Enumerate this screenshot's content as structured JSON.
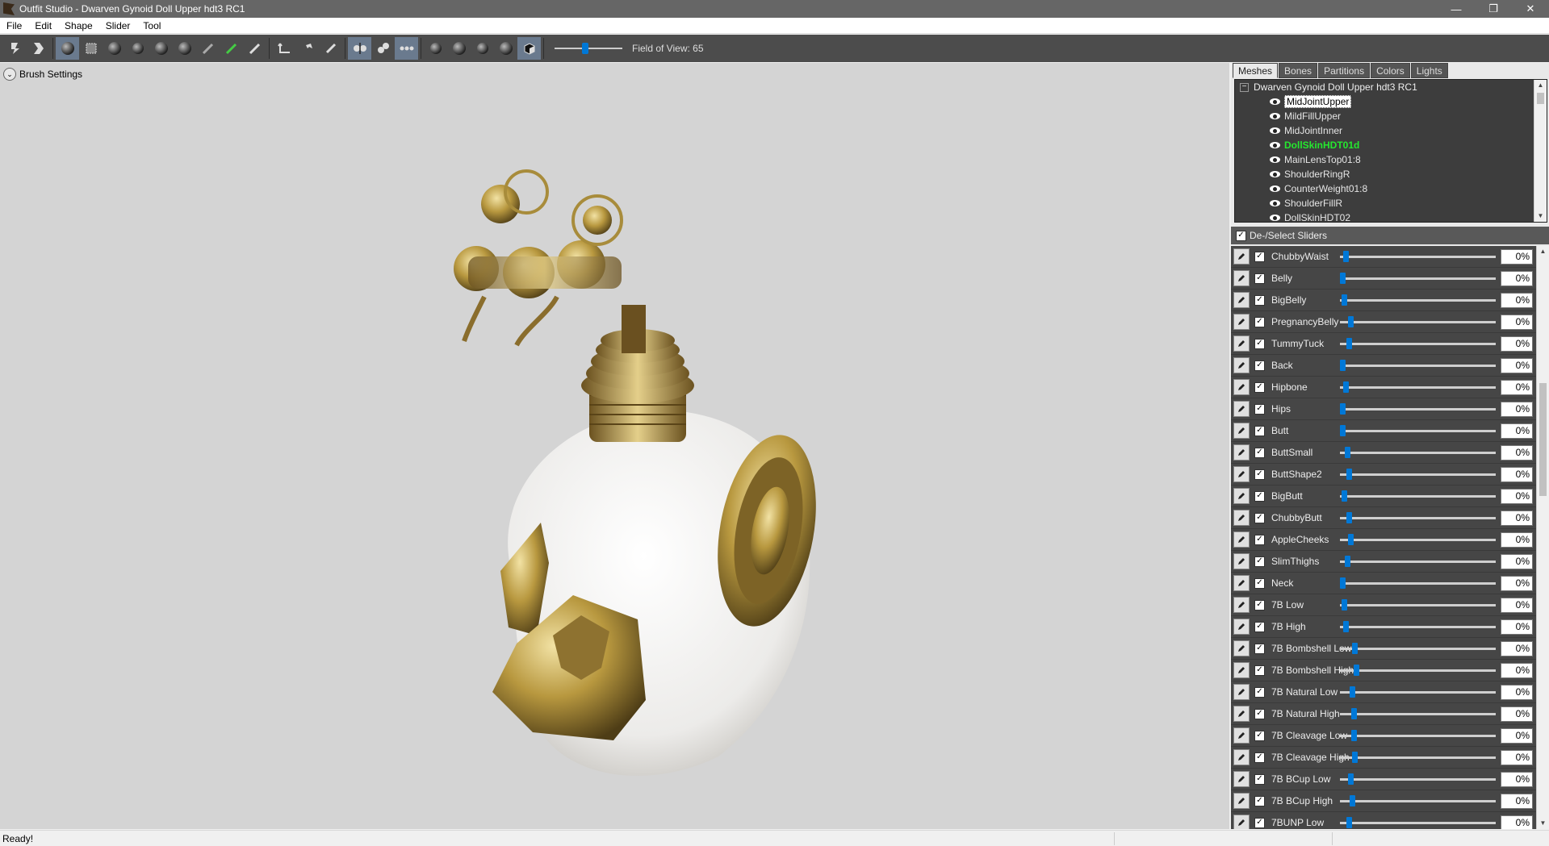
{
  "window": {
    "title": "Outfit Studio - Dwarven Gynoid Doll Upper hdt3 RC1",
    "controls": [
      "—",
      "❐",
      "✕"
    ]
  },
  "menu": [
    "File",
    "Edit",
    "Shape",
    "Slider",
    "Tool"
  ],
  "toolbar": {
    "field_of_view_label": "Field of View: 65",
    "field_of_view_level": 0.45,
    "icons": [
      "save-project-icon",
      "load-project-icon",
      "select-brush-icon",
      "mask-brush-icon",
      "inflate-brush-icon",
      "deflate-brush-icon",
      "move-brush-icon",
      "smooth-brush-icon",
      "undiff-brush-icon",
      "weight-brush-icon",
      "color-brush-icon",
      "transform-tool-icon",
      "pivot-tool-icon",
      "vertex-edit-icon",
      "x-mirror-icon",
      "connected-only-icon",
      "global-brush-icon",
      "view-front-icon",
      "view-back-icon",
      "view-left-icon",
      "view-right-icon",
      "perspective-icon"
    ]
  },
  "viewport": {
    "brush_settings_label": "Brush Settings"
  },
  "tabs": [
    {
      "label": "Meshes",
      "active": true
    },
    {
      "label": "Bones",
      "active": false
    },
    {
      "label": "Partitions",
      "active": false
    },
    {
      "label": "Colors",
      "active": false
    },
    {
      "label": "Lights",
      "active": false
    }
  ],
  "mesh_tree": {
    "root": "Dwarven Gynoid Doll Upper hdt3 RC1",
    "items": [
      {
        "label": "MidJointUpper",
        "state": "selected"
      },
      {
        "label": "MildFillUpper",
        "state": "normal"
      },
      {
        "label": "MidJointInner",
        "state": "normal"
      },
      {
        "label": "DollSkinHDT01d",
        "state": "green"
      },
      {
        "label": "MainLensTop01:8",
        "state": "normal"
      },
      {
        "label": "ShoulderRingR",
        "state": "normal"
      },
      {
        "label": "CounterWeight01:8",
        "state": "normal"
      },
      {
        "label": "ShoulderFillR",
        "state": "normal"
      },
      {
        "label": "DollSkinHDT02",
        "state": "normal"
      }
    ]
  },
  "sliders_header": "De-/Select Sliders",
  "sliders": [
    {
      "name": "ChubbyWaist",
      "value": "0%",
      "thumb": 0.02
    },
    {
      "name": "Belly",
      "value": "0%",
      "thumb": 0.0
    },
    {
      "name": "BigBelly",
      "value": "0%",
      "thumb": 0.01
    },
    {
      "name": "PregnancyBelly",
      "value": "0%",
      "thumb": 0.05
    },
    {
      "name": "TummyTuck",
      "value": "0%",
      "thumb": 0.04
    },
    {
      "name": "Back",
      "value": "0%",
      "thumb": 0.0
    },
    {
      "name": "Hipbone",
      "value": "0%",
      "thumb": 0.02
    },
    {
      "name": "Hips",
      "value": "0%",
      "thumb": 0.0
    },
    {
      "name": "Butt",
      "value": "0%",
      "thumb": 0.0
    },
    {
      "name": "ButtSmall",
      "value": "0%",
      "thumb": 0.03
    },
    {
      "name": "ButtShape2",
      "value": "0%",
      "thumb": 0.04
    },
    {
      "name": "BigButt",
      "value": "0%",
      "thumb": 0.01
    },
    {
      "name": "ChubbyButt",
      "value": "0%",
      "thumb": 0.04
    },
    {
      "name": "AppleCheeks",
      "value": "0%",
      "thumb": 0.05
    },
    {
      "name": "SlimThighs",
      "value": "0%",
      "thumb": 0.03
    },
    {
      "name": "Neck",
      "value": "0%",
      "thumb": 0.0
    },
    {
      "name": "7B Low",
      "value": "0%",
      "thumb": 0.01
    },
    {
      "name": "7B High",
      "value": "0%",
      "thumb": 0.02
    },
    {
      "name": "7B Bombshell Low",
      "value": "0%",
      "thumb": 0.08
    },
    {
      "name": "7B Bombshell High",
      "value": "0%",
      "thumb": 0.09
    },
    {
      "name": "7B Natural Low",
      "value": "0%",
      "thumb": 0.06
    },
    {
      "name": "7B Natural High",
      "value": "0%",
      "thumb": 0.07
    },
    {
      "name": "7B Cleavage Low",
      "value": "0%",
      "thumb": 0.07
    },
    {
      "name": "7B Cleavage High",
      "value": "0%",
      "thumb": 0.08
    },
    {
      "name": "7B BCup Low",
      "value": "0%",
      "thumb": 0.05
    },
    {
      "name": "7B BCup High",
      "value": "0%",
      "thumb": 0.06
    },
    {
      "name": "7BUNP Low",
      "value": "0%",
      "thumb": 0.04
    }
  ],
  "status": "Ready!"
}
